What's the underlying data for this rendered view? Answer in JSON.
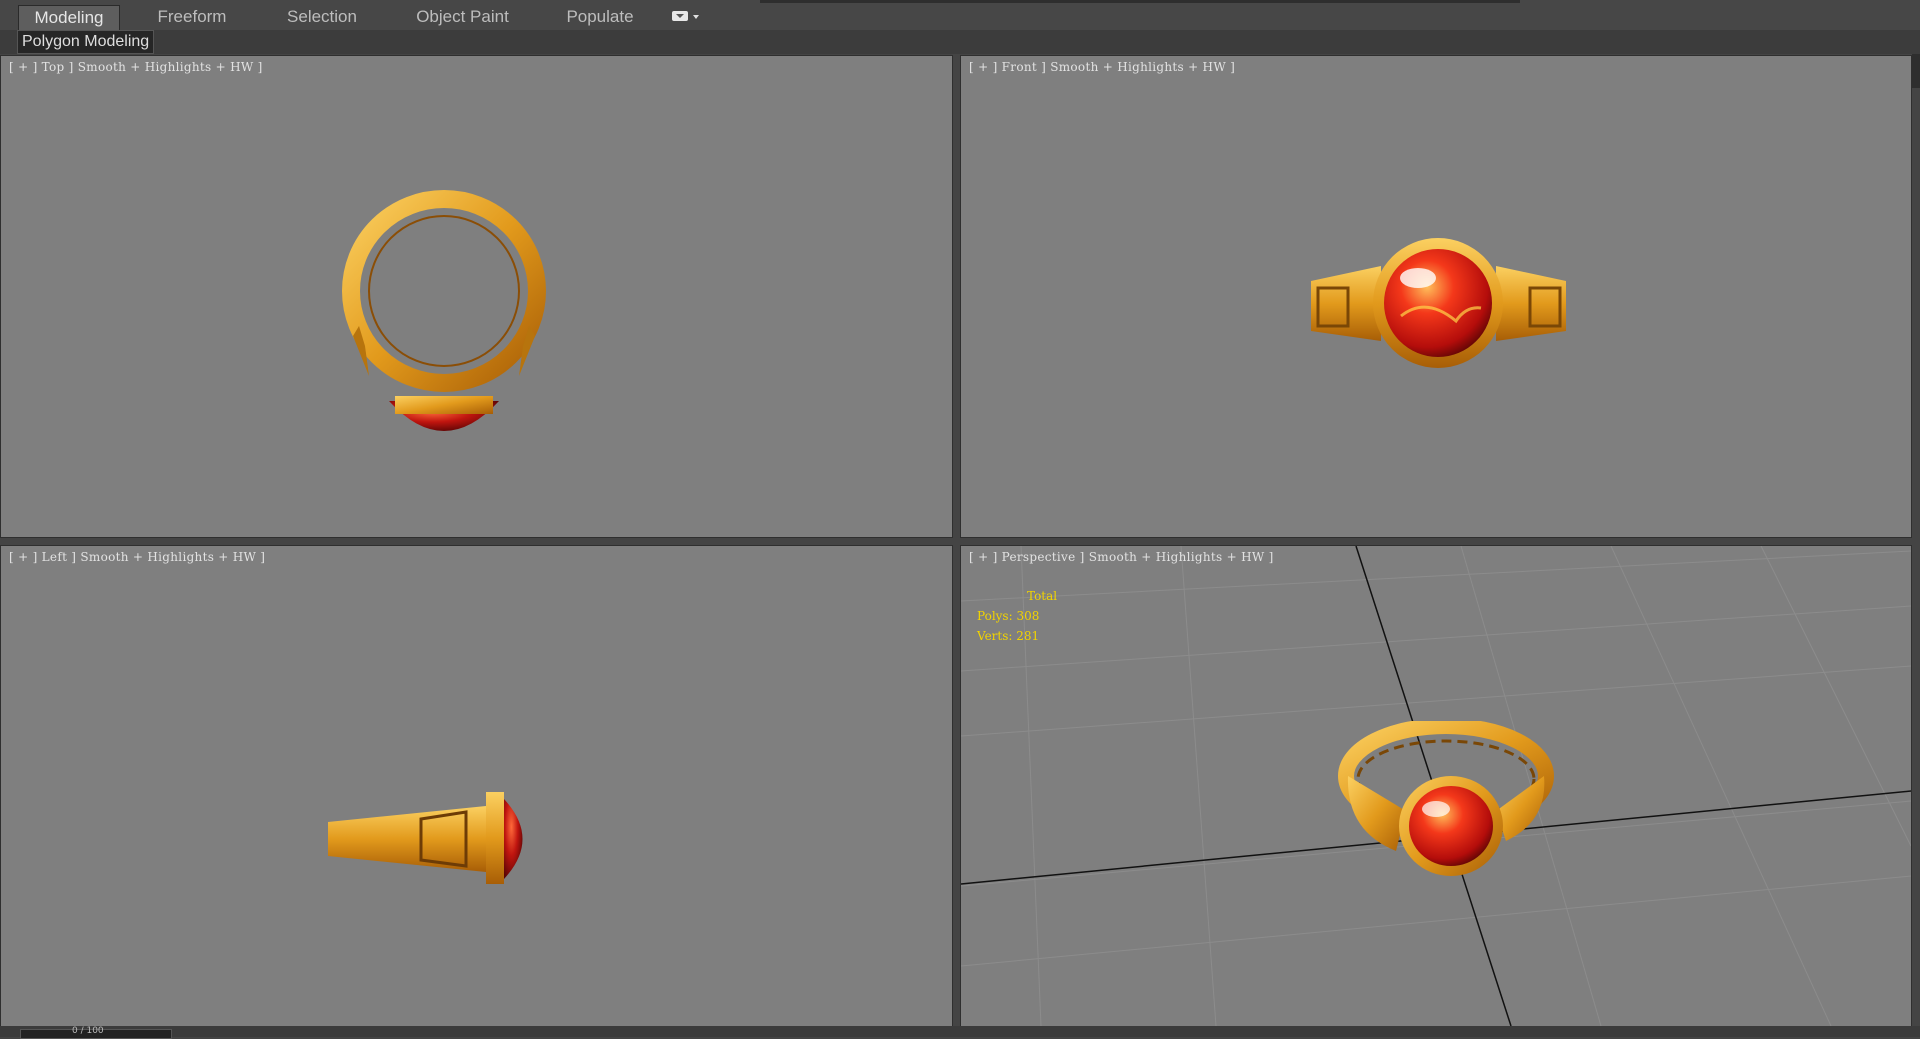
{
  "ribbon": {
    "tabs": [
      {
        "label": "Modeling",
        "active": true
      },
      {
        "label": "Freeform",
        "active": false
      },
      {
        "label": "Selection",
        "active": false
      },
      {
        "label": "Object Paint",
        "active": false
      },
      {
        "label": "Populate",
        "active": false
      }
    ],
    "panel_label": "Polygon Modeling"
  },
  "viewports": {
    "top": {
      "label": "[ + ] Top ] Smooth + Highlights + HW ]"
    },
    "front": {
      "label": "[ + ] Front ] Smooth + Highlights + HW ]"
    },
    "left": {
      "label": "[ + ] Left ] Smooth + Highlights + HW ]"
    },
    "perspective": {
      "label": "[ + ] Perspective ] Smooth + Highlights + HW ]"
    }
  },
  "stats": {
    "total_label": "Total",
    "polys": "Polys: 308",
    "verts": "Verts: 281"
  },
  "timeline": {
    "counter": "0 / 100"
  },
  "colors": {
    "viewport_bg": "#7f7f7f",
    "gold": "#e7a52a",
    "gem": "#c0150f",
    "stats_text": "#f2d400"
  }
}
